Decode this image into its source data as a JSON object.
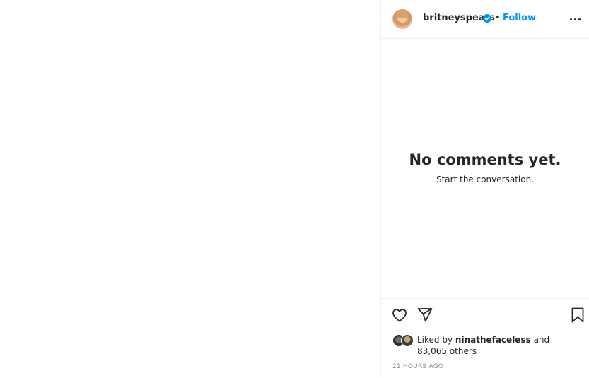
{
  "post": {
    "username": "britneyspears",
    "separator": "•",
    "follow_label": "Follow",
    "verified_icon": "verified-badge-icon",
    "more_icon": "more-options-icon"
  },
  "comments": {
    "empty_title": "No comments yet.",
    "empty_subtitle": "Start the conversation."
  },
  "actions": {
    "like_icon": "heart-icon",
    "share_icon": "send-icon",
    "save_icon": "bookmark-icon"
  },
  "likes": {
    "prefix": "Liked by",
    "user": "ninathefaceless",
    "suffix": "and 83,065 others"
  },
  "timestamp": "21 HOURS AGO",
  "colors": {
    "accent": "#0095f6",
    "text": "#262626",
    "muted": "#8e8e8e",
    "border": "#efefef"
  }
}
